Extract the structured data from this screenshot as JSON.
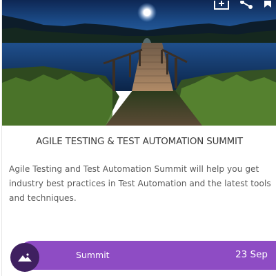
{
  "event": {
    "title": "AGILE TESTING & TEST AUTOMATION SUMMIT",
    "description": "Agile Testing and Test Automation Summit will help you get industry best practices in Test Automation and the latest tools and techniques.",
    "category": "Summit",
    "date": "23 Sep"
  },
  "hero": {
    "image_subject": "wooden pier over a calm lake at night under a full moon",
    "actions": [
      "add-to-calendar-icon",
      "share-icon",
      "bookmark-icon"
    ]
  },
  "colors": {
    "accent_bar": "#8e4cc4",
    "badge": "#3f2060",
    "title_text": "#3a3a3a",
    "body_text": "#5a5a5a"
  }
}
